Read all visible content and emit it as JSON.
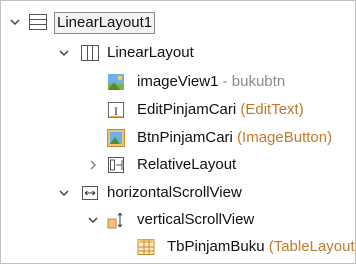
{
  "tree": {
    "nodes": [
      {
        "id": "n1",
        "label": "LinearLayout1",
        "subtitle": "",
        "expand": "expanded",
        "icon": "linear-layout-vertical-icon"
      },
      {
        "id": "n2",
        "label": "LinearLayout",
        "subtitle": "",
        "expand": "expanded",
        "icon": "linear-layout-horizontal-icon"
      },
      {
        "id": "n3",
        "label": "imageView1",
        "subtitle": " - bukubtn",
        "expand": "none",
        "icon": "image-view-icon"
      },
      {
        "id": "n4",
        "label": "EditPinjamCari",
        "subtitle": " (EditText)",
        "expand": "none",
        "icon": "edit-text-icon"
      },
      {
        "id": "n5",
        "label": "BtnPinjamCari",
        "subtitle": " (ImageButton)",
        "expand": "none",
        "icon": "image-button-icon"
      },
      {
        "id": "n6",
        "label": "RelativeLayout",
        "subtitle": "",
        "expand": "collapsed",
        "icon": "relative-layout-icon"
      },
      {
        "id": "n7",
        "label": "horizontalScrollView",
        "subtitle": "",
        "expand": "expanded",
        "icon": "horizontal-scroll-view-icon"
      },
      {
        "id": "n8",
        "label": "verticalScrollView",
        "subtitle": "",
        "expand": "expanded",
        "icon": "vertical-scroll-view-icon"
      },
      {
        "id": "n9",
        "label": "TbPinjamBuku",
        "subtitle": " (TableLayout)",
        "expand": "none",
        "icon": "table-layout-icon"
      }
    ]
  },
  "colors": {
    "chevron": "#444444",
    "subtitle_gray": "#8a8a8a",
    "subtitle_orange": "#c07a2a",
    "icon_blue": "#5b8fd6",
    "icon_orange": "#e8a33c"
  }
}
